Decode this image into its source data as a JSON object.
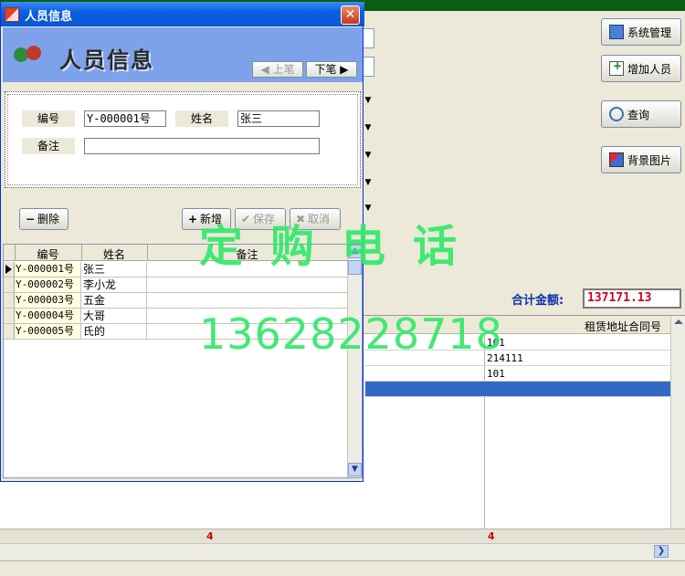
{
  "dialog": {
    "title": "人员信息",
    "heading": "人员信息",
    "nav": {
      "prev": "上笔",
      "next": "下笔"
    },
    "form": {
      "id_label": "编号",
      "id_value": "Y-000001号",
      "name_label": "姓名",
      "name_value": "张三",
      "remark_label": "备注",
      "remark_value": ""
    },
    "actions": {
      "delete": "删除",
      "new": "新增",
      "save": "保存",
      "cancel": "取消"
    },
    "grid": {
      "headers": [
        "编号",
        "姓名",
        "备注"
      ],
      "rows": [
        {
          "id": "Y-000001号",
          "name": "张三",
          "remark": ""
        },
        {
          "id": "Y-000002号",
          "name": "李小龙",
          "remark": ""
        },
        {
          "id": "Y-000003号",
          "name": "五金",
          "remark": ""
        },
        {
          "id": "Y-000004号",
          "name": "大哥",
          "remark": ""
        },
        {
          "id": "Y-000005号",
          "name": "氏的",
          "remark": ""
        }
      ]
    }
  },
  "sidebar": {
    "system": "系统管理",
    "add_person": "增加人员",
    "query": "查询",
    "background": "背景图片"
  },
  "totals": {
    "label": "合计金额:",
    "value": "137171.13"
  },
  "main_grid": {
    "header": "租赁地址合同号",
    "rows": [
      "101",
      "214111",
      "101",
      ""
    ],
    "summary_left": "4",
    "summary_right": "4"
  },
  "watermark": {
    "title": "定购电话",
    "phone": "13628228718"
  },
  "colors": {
    "accent": "#0a5fe0",
    "watermark": "#33e86b",
    "total": "#d4001b",
    "selection": "#316ac5"
  }
}
